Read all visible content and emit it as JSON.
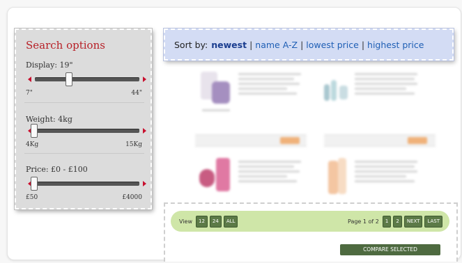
{
  "search_options": {
    "title": "Search options",
    "display": {
      "label": "Display: 19\"",
      "min": "7\"",
      "max": "44\"",
      "value": 19,
      "range": [
        7,
        44
      ]
    },
    "weight": {
      "label": "Weight: 4kg",
      "min": "4Kg",
      "max": "15Kg",
      "value": 4,
      "range": [
        4,
        15
      ]
    },
    "price": {
      "label": "Price: £0 - £100",
      "min": "£50",
      "max": "£4000",
      "value": 50,
      "range": [
        50,
        4000
      ]
    }
  },
  "sort": {
    "label": "Sort by:",
    "options": [
      {
        "text": "newest",
        "active": true
      },
      {
        "text": "name A-Z",
        "active": false
      },
      {
        "text": "lowest price",
        "active": false
      },
      {
        "text": "highest price",
        "active": false
      }
    ],
    "separator": "|"
  },
  "pagination": {
    "view_label": "View",
    "view_options": [
      "12",
      "24",
      "ALL"
    ],
    "page_status": "Page 1 of 2",
    "pages": [
      "1",
      "2"
    ],
    "next": "NEXT",
    "last": "LAST",
    "compare_button": "COMPARE SELECTED"
  },
  "colors": {
    "title_red": "#b71f26",
    "slider_arrow": "#c8102e",
    "sort_link": "#1f5fb5",
    "sort_bar_bg": "#d3dcf4",
    "pager_bg": "#cfe6a8",
    "pager_button": "#5c7a47"
  }
}
